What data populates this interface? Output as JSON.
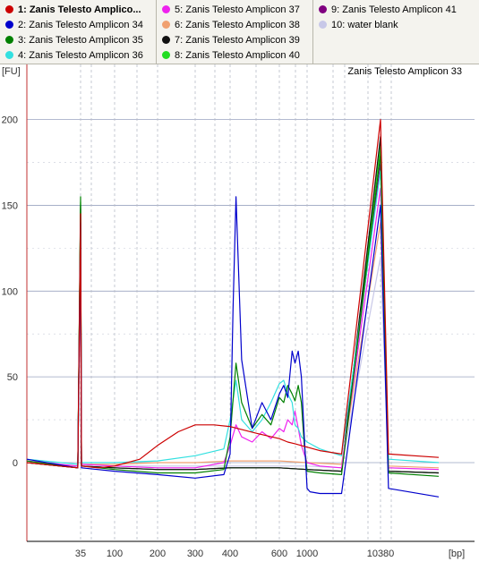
{
  "legend": {
    "items": [
      {
        "label": "1: Zanis Telesto Amplicon 33",
        "display": "1: Zanis Telesto Amplico...",
        "color": "#cc0000",
        "selected": true
      },
      {
        "label": "2: Zanis Telesto Amplicon 34",
        "color": "#0000cc"
      },
      {
        "label": "3: Zanis Telesto Amplicon 35",
        "color": "#008000"
      },
      {
        "label": "4: Zanis Telesto Amplicon 36",
        "color": "#33e0e0"
      },
      {
        "label": "5: Zanis Telesto Amplicon 37",
        "color": "#ee22ee"
      },
      {
        "label": "6: Zanis Telesto Amplicon 38",
        "color": "#f0a070"
      },
      {
        "label": "7: Zanis Telesto Amplicon 39",
        "color": "#111111"
      },
      {
        "label": "8: Zanis Telesto Amplicon 40",
        "color": "#22dd22"
      },
      {
        "label": "9: Zanis Telesto Amplicon 41",
        "color": "#800080"
      },
      {
        "label": "10: water blank",
        "color": "#c8c8e8"
      }
    ]
  },
  "chart_data": {
    "type": "line",
    "title": "Zanis Telesto Amplicon 33",
    "xlabel": "[bp]",
    "ylabel": "[FU]",
    "ylim": [
      -30,
      200
    ],
    "x_ticks": [
      "35",
      "100",
      "200",
      "300",
      "400",
      "600",
      "1000",
      "10380"
    ],
    "y_ticks": [
      0,
      50,
      100,
      150,
      200
    ],
    "tick_labels": {
      "x": [
        "35",
        "100",
        "200",
        "300",
        "400",
        "600",
        "1000",
        "10380"
      ],
      "y": [
        "0",
        "50",
        "100",
        "150",
        "200"
      ]
    },
    "x_axis_scale": "ladder (non-linear)",
    "grid": true,
    "series": [
      {
        "name": "1: Zanis Telesto Amplicon 33",
        "color": "#cc0000",
        "points": [
          [
            20,
            0
          ],
          [
            34,
            -3
          ],
          [
            35,
            145
          ],
          [
            36,
            -2
          ],
          [
            60,
            -3
          ],
          [
            100,
            -2
          ],
          [
            150,
            2
          ],
          [
            200,
            10
          ],
          [
            250,
            18
          ],
          [
            300,
            22
          ],
          [
            350,
            22
          ],
          [
            400,
            21
          ],
          [
            500,
            17
          ],
          [
            600,
            14
          ],
          [
            700,
            12
          ],
          [
            800,
            11
          ],
          [
            1000,
            9
          ],
          [
            1500,
            7
          ],
          [
            3000,
            5
          ],
          [
            10380,
            200
          ],
          [
            12000,
            5
          ],
          [
            30000,
            3
          ]
        ]
      },
      {
        "name": "2: Zanis Telesto Amplicon 34",
        "color": "#0000cc",
        "points": [
          [
            20,
            2
          ],
          [
            34,
            -3
          ],
          [
            35,
            140
          ],
          [
            36,
            -3
          ],
          [
            100,
            -5
          ],
          [
            200,
            -7
          ],
          [
            300,
            -9
          ],
          [
            380,
            -7
          ],
          [
            400,
            5
          ],
          [
            410,
            90
          ],
          [
            420,
            155
          ],
          [
            440,
            60
          ],
          [
            480,
            20
          ],
          [
            520,
            35
          ],
          [
            560,
            25
          ],
          [
            600,
            40
          ],
          [
            650,
            45
          ],
          [
            700,
            38
          ],
          [
            760,
            65
          ],
          [
            800,
            58
          ],
          [
            850,
            65
          ],
          [
            900,
            50
          ],
          [
            950,
            15
          ],
          [
            1000,
            -15
          ],
          [
            1100,
            -17
          ],
          [
            1500,
            -18
          ],
          [
            3000,
            -18
          ],
          [
            10380,
            150
          ],
          [
            12000,
            -15
          ],
          [
            30000,
            -20
          ]
        ]
      },
      {
        "name": "3: Zanis Telesto Amplicon 35",
        "color": "#008000",
        "points": [
          [
            20,
            1
          ],
          [
            34,
            -3
          ],
          [
            35,
            155
          ],
          [
            36,
            -2
          ],
          [
            100,
            -4
          ],
          [
            200,
            -6
          ],
          [
            300,
            -6
          ],
          [
            380,
            -4
          ],
          [
            400,
            15
          ],
          [
            420,
            58
          ],
          [
            440,
            35
          ],
          [
            480,
            20
          ],
          [
            520,
            28
          ],
          [
            560,
            22
          ],
          [
            600,
            38
          ],
          [
            650,
            35
          ],
          [
            700,
            45
          ],
          [
            760,
            40
          ],
          [
            800,
            36
          ],
          [
            850,
            45
          ],
          [
            900,
            35
          ],
          [
            950,
            10
          ],
          [
            1000,
            -5
          ],
          [
            1500,
            -6
          ],
          [
            3000,
            -7
          ],
          [
            10380,
            180
          ],
          [
            12000,
            -6
          ],
          [
            30000,
            -8
          ]
        ]
      },
      {
        "name": "4: Zanis Telesto Amplicon 36",
        "color": "#33e0e0",
        "points": [
          [
            20,
            2
          ],
          [
            34,
            -1
          ],
          [
            35,
            140
          ],
          [
            36,
            0
          ],
          [
            100,
            0
          ],
          [
            200,
            1
          ],
          [
            300,
            4
          ],
          [
            380,
            8
          ],
          [
            400,
            25
          ],
          [
            420,
            48
          ],
          [
            440,
            25
          ],
          [
            480,
            18
          ],
          [
            520,
            25
          ],
          [
            560,
            35
          ],
          [
            600,
            46
          ],
          [
            650,
            48
          ],
          [
            700,
            40
          ],
          [
            760,
            35
          ],
          [
            800,
            22
          ],
          [
            850,
            20
          ],
          [
            900,
            15
          ],
          [
            1000,
            12
          ],
          [
            1500,
            8
          ],
          [
            3000,
            4
          ],
          [
            10380,
            170
          ],
          [
            12000,
            2
          ],
          [
            30000,
            0
          ]
        ]
      },
      {
        "name": "5: Zanis Telesto Amplicon 37",
        "color": "#ee22ee",
        "points": [
          [
            20,
            1
          ],
          [
            34,
            -2
          ],
          [
            35,
            130
          ],
          [
            36,
            -1
          ],
          [
            100,
            -2
          ],
          [
            200,
            -3
          ],
          [
            300,
            -3
          ],
          [
            380,
            0
          ],
          [
            400,
            10
          ],
          [
            420,
            22
          ],
          [
            440,
            15
          ],
          [
            480,
            12
          ],
          [
            520,
            18
          ],
          [
            560,
            14
          ],
          [
            600,
            20
          ],
          [
            650,
            18
          ],
          [
            700,
            25
          ],
          [
            760,
            22
          ],
          [
            800,
            30
          ],
          [
            850,
            20
          ],
          [
            900,
            10
          ],
          [
            1000,
            0
          ],
          [
            1500,
            -2
          ],
          [
            3000,
            -3
          ],
          [
            10380,
            160
          ],
          [
            12000,
            -3
          ],
          [
            30000,
            -4
          ]
        ]
      },
      {
        "name": "6: Zanis Telesto Amplicon 38",
        "color": "#f0a070",
        "points": [
          [
            20,
            0
          ],
          [
            34,
            -2
          ],
          [
            35,
            120
          ],
          [
            36,
            -1
          ],
          [
            100,
            -1
          ],
          [
            200,
            0
          ],
          [
            300,
            0
          ],
          [
            400,
            1
          ],
          [
            600,
            1
          ],
          [
            1000,
            0
          ],
          [
            3000,
            -1
          ],
          [
            10380,
            140
          ],
          [
            12000,
            -2
          ],
          [
            30000,
            -3
          ]
        ]
      },
      {
        "name": "7: Zanis Telesto Amplicon 39",
        "color": "#111111",
        "points": [
          [
            20,
            0
          ],
          [
            34,
            -3
          ],
          [
            35,
            150
          ],
          [
            36,
            -2
          ],
          [
            100,
            -3
          ],
          [
            200,
            -4
          ],
          [
            300,
            -4
          ],
          [
            400,
            -3
          ],
          [
            600,
            -3
          ],
          [
            1000,
            -4
          ],
          [
            3000,
            -5
          ],
          [
            10380,
            190
          ],
          [
            12000,
            -5
          ],
          [
            30000,
            -6
          ]
        ]
      },
      {
        "name": "8: Zanis Telesto Amplicon 40",
        "color": "#22dd22",
        "points": [
          [
            20,
            0
          ],
          [
            34,
            -3
          ],
          [
            35,
            152
          ],
          [
            36,
            -2
          ],
          [
            100,
            -3
          ],
          [
            200,
            -4
          ],
          [
            300,
            -4
          ],
          [
            400,
            -3
          ],
          [
            600,
            -3
          ],
          [
            1000,
            -4
          ],
          [
            3000,
            -5
          ],
          [
            10380,
            185
          ],
          [
            12000,
            -5
          ],
          [
            30000,
            -6
          ]
        ]
      },
      {
        "name": "9: Zanis Telesto Amplicon 41",
        "color": "#800080",
        "points": [
          [
            20,
            0
          ],
          [
            34,
            -3
          ],
          [
            35,
            148
          ],
          [
            36,
            -2
          ],
          [
            100,
            -3
          ],
          [
            200,
            -4
          ],
          [
            300,
            -4
          ],
          [
            400,
            -3
          ],
          [
            600,
            -3
          ],
          [
            1000,
            -4
          ],
          [
            3000,
            -5
          ],
          [
            10380,
            175
          ],
          [
            12000,
            -5
          ],
          [
            30000,
            -6
          ]
        ]
      },
      {
        "name": "10: water blank",
        "color": "#c8c8e8",
        "points": [
          [
            20,
            0
          ],
          [
            34,
            -2
          ],
          [
            35,
            100
          ],
          [
            36,
            -1
          ],
          [
            100,
            -2
          ],
          [
            200,
            -2
          ],
          [
            300,
            -2
          ],
          [
            400,
            -2
          ],
          [
            600,
            -2
          ],
          [
            1000,
            -2
          ],
          [
            3000,
            -3
          ],
          [
            10380,
            120
          ],
          [
            12000,
            -3
          ],
          [
            30000,
            -4
          ]
        ]
      }
    ]
  }
}
